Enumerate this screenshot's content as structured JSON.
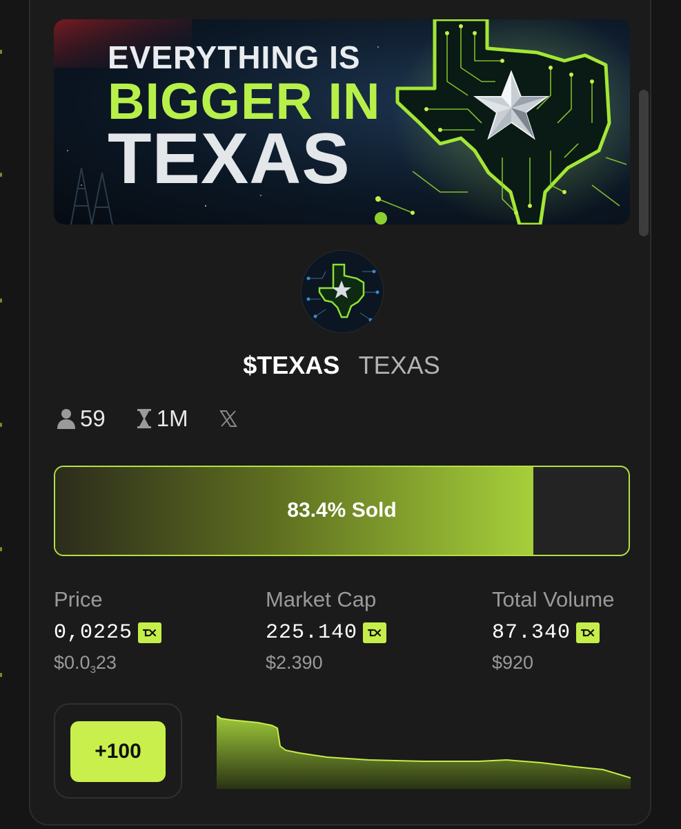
{
  "banner": {
    "line1": "EVERYTHING IS",
    "line2": "BIGGER IN",
    "line3": "TEXAS"
  },
  "token": {
    "ticker": "$TEXAS",
    "name": "TEXAS"
  },
  "stats": {
    "holders": "59",
    "supply": "1M"
  },
  "progress": {
    "percent_sold": 83.4,
    "label": "83.4% Sold"
  },
  "metrics": {
    "price": {
      "label": "Price",
      "value": "0,0225",
      "usd_prefix": "$0.0",
      "usd_sub": "3",
      "usd_suffix": "23"
    },
    "market_cap": {
      "label": "Market Cap",
      "value": "225.140",
      "usd": "$2.390"
    },
    "total_volume": {
      "label": "Total Volume",
      "value": "87.340",
      "usd": "$920"
    }
  },
  "actions": {
    "quick_buy_label": "+100"
  },
  "colors": {
    "accent": "#c6ee4a",
    "background": "#1b1b1b",
    "muted_text": "#9a9a9a"
  },
  "icons": {
    "holders": "user-icon",
    "supply": "hourglass-icon",
    "social": "x-logo-icon",
    "currency": "token-badge-icon"
  }
}
